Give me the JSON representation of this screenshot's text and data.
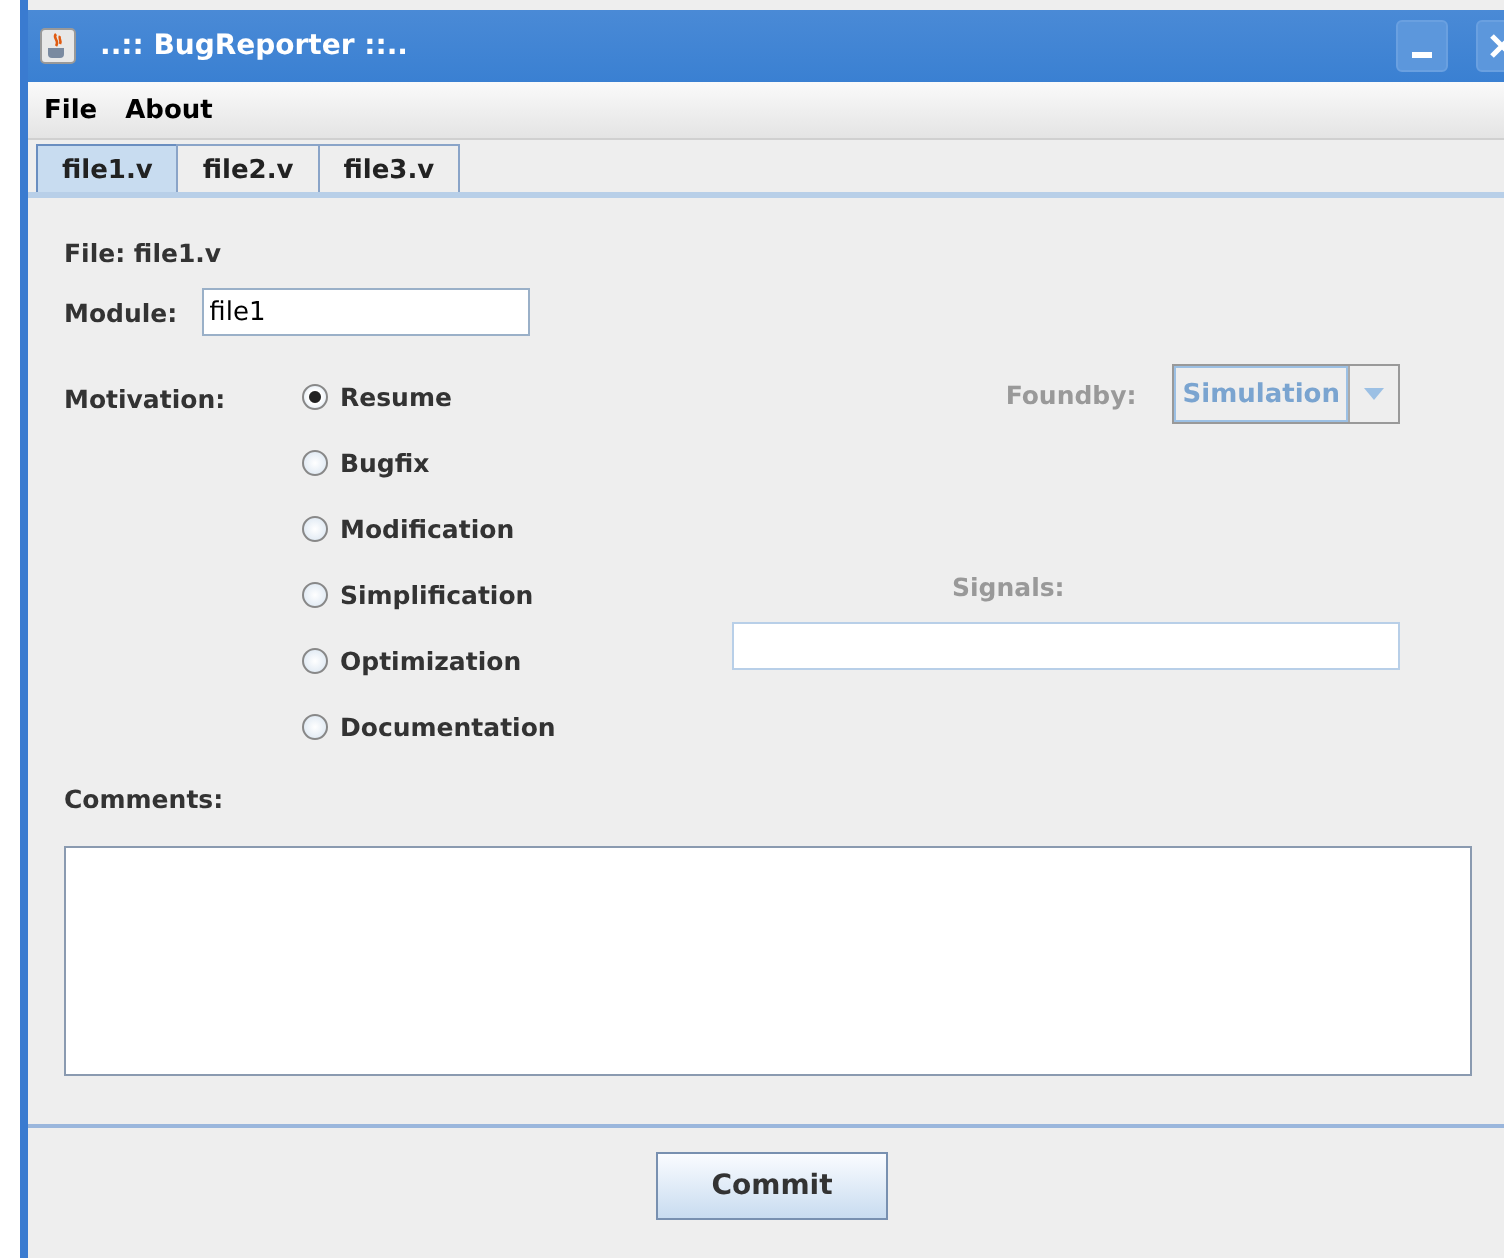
{
  "window": {
    "title": "..:: BugReporter ::.."
  },
  "menu": [
    "File",
    "About"
  ],
  "tabs": [
    {
      "label": "file1.v",
      "selected": true
    },
    {
      "label": "file2.v",
      "selected": false
    },
    {
      "label": "file3.v",
      "selected": false
    }
  ],
  "file_label": "File: file1.v",
  "module": {
    "label": "Module:",
    "value": "file1"
  },
  "motivation": {
    "label": "Motivation:",
    "options": [
      {
        "label": "Resume",
        "selected": true
      },
      {
        "label": "Bugfix",
        "selected": false
      },
      {
        "label": "Modification",
        "selected": false
      },
      {
        "label": "Simplification",
        "selected": false
      },
      {
        "label": "Optimization",
        "selected": false
      },
      {
        "label": "Documentation",
        "selected": false
      }
    ]
  },
  "foundby": {
    "label": "Foundby:",
    "value": "Simulation",
    "disabled": true
  },
  "signals": {
    "label": "Signals:",
    "disabled": true
  },
  "comments": {
    "label": "Comments:"
  },
  "buttons": [
    "Commit"
  ]
}
